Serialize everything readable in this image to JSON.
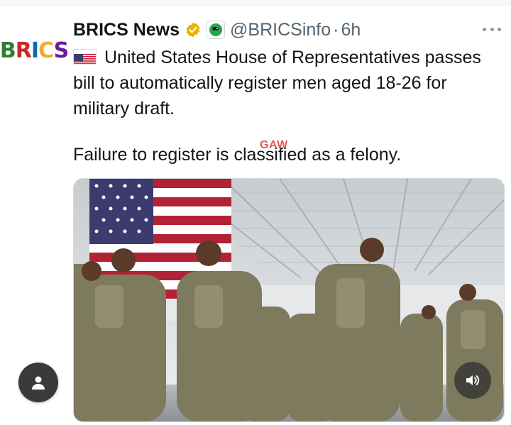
{
  "tweet": {
    "avatar_text": "BRICS",
    "display_name": "BRICS News",
    "handle": "@BRICSinfo",
    "separator": "·",
    "time": "6h",
    "text_line1": "United States House of Representatives passes bill to automatically register men aged 18-26 for military draft.",
    "text_line2": "Failure to register is classified as a felony.",
    "watermark": "GAW"
  },
  "icons": {
    "verified": "verified-gold-badge-icon",
    "affiliate": "affiliate-badge-icon",
    "flag": "us-flag-icon",
    "more": "more-options-icon",
    "profile": "person-icon",
    "sound": "speaker-icon"
  },
  "colors": {
    "text": "#0f1419",
    "secondary": "#536471",
    "verified": "#e8b400",
    "watermark": "#e53935"
  }
}
